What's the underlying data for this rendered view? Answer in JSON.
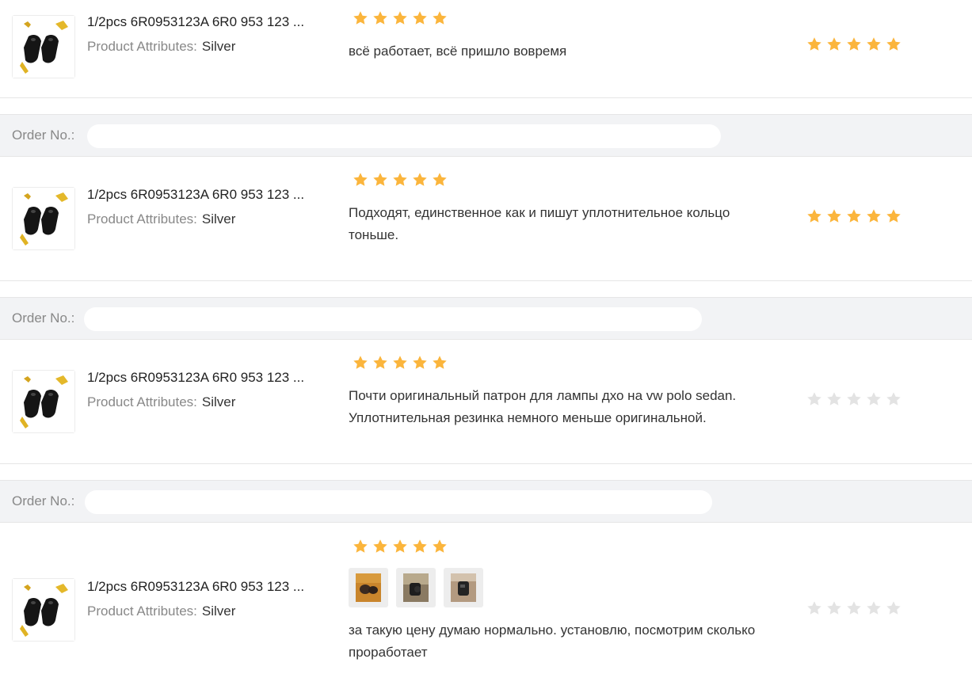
{
  "order_label": "Order No.:",
  "attr_label": "Product Attributes:",
  "colors": {
    "star_on": "#fbb53c",
    "star_off": "#e3e3e3",
    "header_bg": "#f2f3f5"
  },
  "items": [
    {
      "product_title": "1/2pcs 6R0953123A 6R0 953 123 ...",
      "attr_value": "Silver",
      "product_rating": 5,
      "review_text": "всё работает, всё пришло вовремя",
      "seller_rating": 5
    },
    {
      "product_title": "1/2pcs 6R0953123A 6R0 953 123 ...",
      "attr_value": "Silver",
      "product_rating": 5,
      "review_text": "Подходят, единственное как и пишут уплотнительное кольцо тоньше.",
      "seller_rating": 5
    },
    {
      "product_title": "1/2pcs 6R0953123A 6R0 953 123 ...",
      "attr_value": "Silver",
      "product_rating": 5,
      "review_text": "Почти оригинальный патрон для лампы дхо на vw polo sedan. Уплотнительная резинка немного меньше оригинальной.",
      "seller_rating": 0
    },
    {
      "product_title": "1/2pcs 6R0953123A 6R0 953 123 ...",
      "attr_value": "Silver",
      "product_rating": 5,
      "photos": [
        "photo-1",
        "photo-2",
        "photo-3"
      ],
      "review_text": "за такую цену думаю нормально. установлю, посмотрим сколько проработает",
      "seller_rating": 0
    }
  ]
}
